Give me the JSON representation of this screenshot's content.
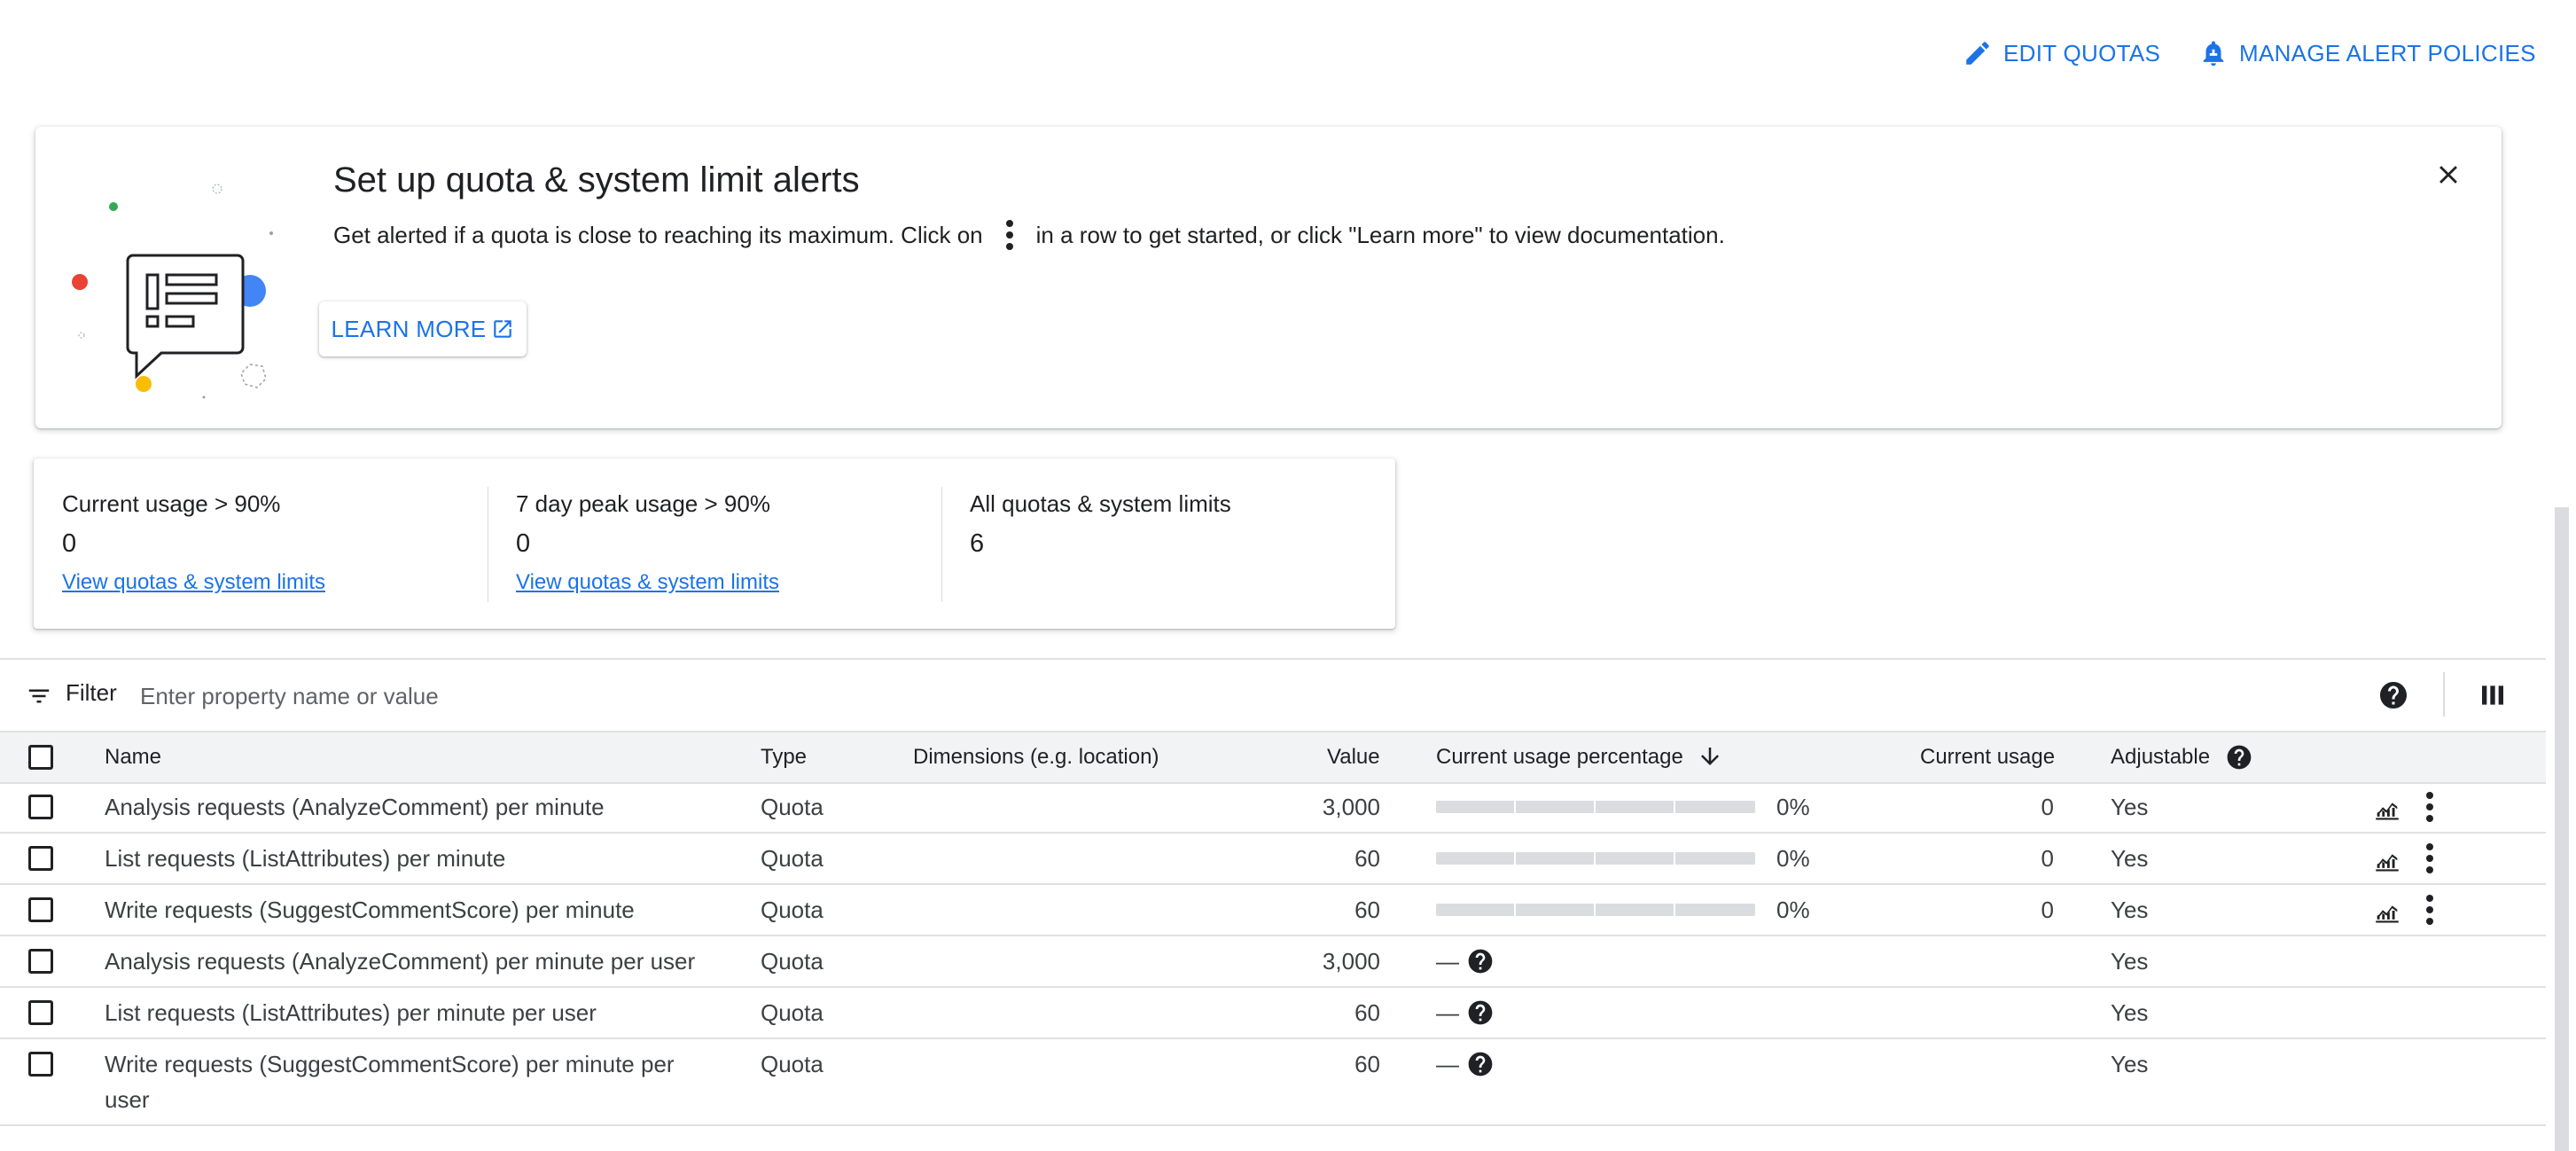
{
  "header": {
    "edit_quotas_label": "EDIT QUOTAS",
    "manage_alerts_label": "MANAGE ALERT POLICIES"
  },
  "banner": {
    "title": "Set up quota & system limit alerts",
    "desc_before": "Get alerted if a quota is close to reaching its maximum. Click on",
    "desc_after": "in a row to get started, or click \"Learn more\" to view documentation.",
    "learn_more_label": "LEARN MORE"
  },
  "stats": [
    {
      "label": "Current usage > 90%",
      "value": "0",
      "link": "View quotas & system limits"
    },
    {
      "label": "7 day peak usage > 90%",
      "value": "0",
      "link": "View quotas & system limits"
    },
    {
      "label": "All quotas & system limits",
      "value": "6"
    }
  ],
  "filter": {
    "label": "Filter",
    "placeholder": "Enter property name or value"
  },
  "table": {
    "columns": {
      "name": "Name",
      "type": "Type",
      "dimensions": "Dimensions (e.g. location)",
      "value": "Value",
      "usage_pct": "Current usage percentage",
      "usage": "Current usage",
      "adjustable": "Adjustable"
    },
    "rows": [
      {
        "name": "Analysis requests (AnalyzeComment) per minute",
        "type": "Quota",
        "value": "3,000",
        "usage_pct": "0%",
        "usage_fraction": 0,
        "usage": "0",
        "adjustable": "Yes"
      },
      {
        "name": "List requests (ListAttributes) per minute",
        "type": "Quota",
        "value": "60",
        "usage_pct": "0%",
        "usage_fraction": 0,
        "usage": "0",
        "adjustable": "Yes"
      },
      {
        "name": "Write requests (SuggestCommentScore) per minute",
        "type": "Quota",
        "value": "60",
        "usage_pct": "0%",
        "usage_fraction": 0,
        "usage": "0",
        "adjustable": "Yes"
      },
      {
        "name": "Analysis requests (AnalyzeComment) per minute per user",
        "type": "Quota",
        "value": "3,000",
        "usage_pct": "—",
        "adjustable": "Yes"
      },
      {
        "name": "List requests (ListAttributes) per minute per user",
        "type": "Quota",
        "value": "60",
        "usage_pct": "—",
        "adjustable": "Yes"
      },
      {
        "name_line1": "Write requests (SuggestCommentScore) per minute per",
        "name_line2": "user",
        "type": "Quota",
        "value": "60",
        "usage_pct": "—",
        "adjustable": "Yes"
      }
    ]
  },
  "colors": {
    "accent": "#1a73e8",
    "header_bg": "#f1f3f4",
    "divider": "#e0e0e0"
  }
}
